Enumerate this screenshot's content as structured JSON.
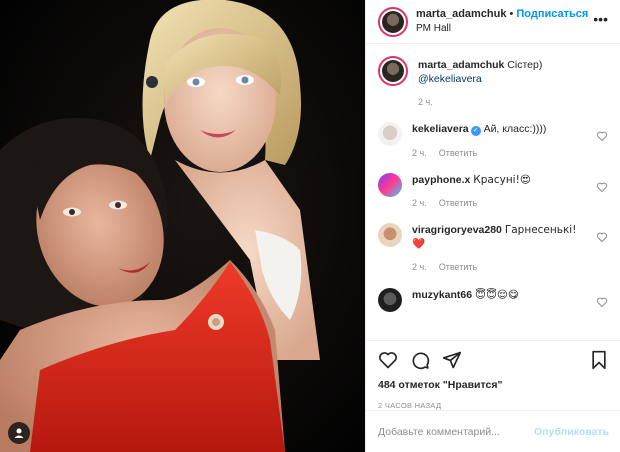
{
  "post": {
    "username": "marta_adamchuk",
    "follow_label": "Подписаться",
    "location": "PM Hall",
    "caption_text": "Сістер)",
    "caption_mention": "@kekeliavera",
    "caption_time": "2 ч."
  },
  "comments": [
    {
      "user": "kekeliavera",
      "verified": true,
      "text": "Ай, класс:))))",
      "time": "2 ч.",
      "reply": "Ответить"
    },
    {
      "user": "payphone.x",
      "verified": false,
      "text": "Красуні!😍",
      "time": "2 ч.",
      "reply": "Ответить"
    },
    {
      "user": "viragrigoryeva280",
      "verified": false,
      "text": "Гарнесенькі! ❤️",
      "time": "2 ч.",
      "reply": "Ответить"
    },
    {
      "user": "muzykant66",
      "verified": false,
      "text": "😇😇😌😋",
      "time": "",
      "reply": ""
    }
  ],
  "actions": {
    "likes": "484 отметок \"Нравится\"",
    "timestamp": "2 ЧАСОВ НАЗАД"
  },
  "add_comment": {
    "placeholder": "Добавьте комментарий...",
    "publish_label": "Опубликовать"
  },
  "colors": {
    "accent": "#0095f6",
    "publish_disabled": "#b2dffc",
    "heart_red": "#ed4956",
    "dress_red": "#e0261b"
  },
  "icons": [
    "more-icon",
    "heart-icon",
    "comment-icon",
    "share-icon",
    "bookmark-icon",
    "tag-user-icon",
    "verified-icon"
  ]
}
